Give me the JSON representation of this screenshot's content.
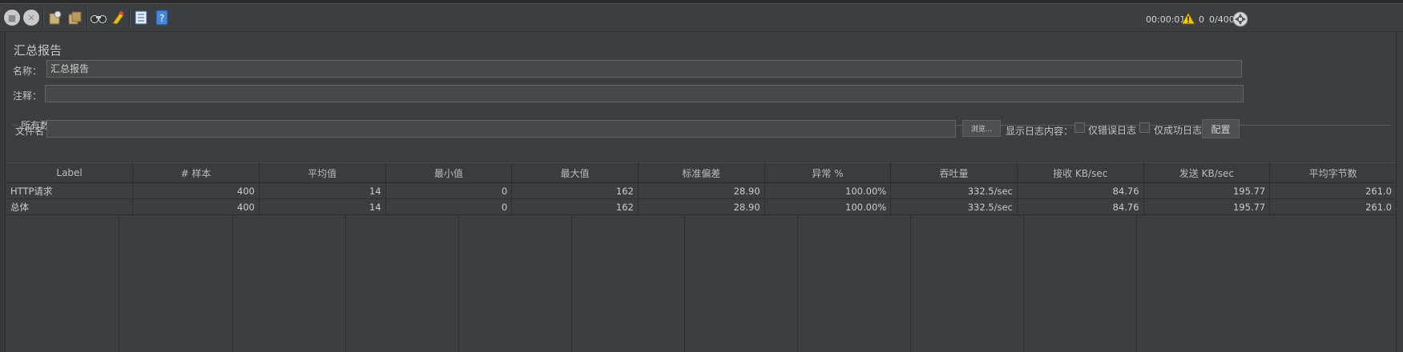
{
  "toolbar": {
    "timer": "00:00:01",
    "warning_count": "0",
    "thread_count": "0/400",
    "icons": [
      "stop-icon",
      "shutdown-icon",
      "clear-icon",
      "clear-all-icon",
      "search-icon",
      "reset-search-icon",
      "function-helper-icon",
      "help-icon",
      "warning-icon",
      "remote-icon"
    ]
  },
  "panel": {
    "title": "汇总报告",
    "name_label": "名称：",
    "name_value": "汇总报告",
    "comment_label": "注释：",
    "comment_value": "",
    "file_group_title": "所有数据写入一个文件",
    "filename_label": "文件名",
    "filename_value": "",
    "browse_label": "浏览...",
    "log_label": "显示日志内容：",
    "errors_only_label": "仅错误日志",
    "success_only_label": "仅成功日志",
    "configure_label": "配置"
  },
  "table": {
    "columns": [
      "Label",
      "# 样本",
      "平均值",
      "最小值",
      "最大值",
      "标准偏差",
      "异常 %",
      "吞吐量",
      "接收 KB/sec",
      "发送 KB/sec",
      "平均字节数"
    ],
    "rows": [
      [
        "HTTP请求",
        "400",
        "14",
        "0",
        "162",
        "28.90",
        "100.00%",
        "332.5/sec",
        "84.76",
        "195.77",
        "261.0"
      ],
      [
        "总体",
        "400",
        "14",
        "0",
        "162",
        "28.90",
        "100.00%",
        "332.5/sec",
        "84.76",
        "195.77",
        "261.0"
      ]
    ]
  }
}
